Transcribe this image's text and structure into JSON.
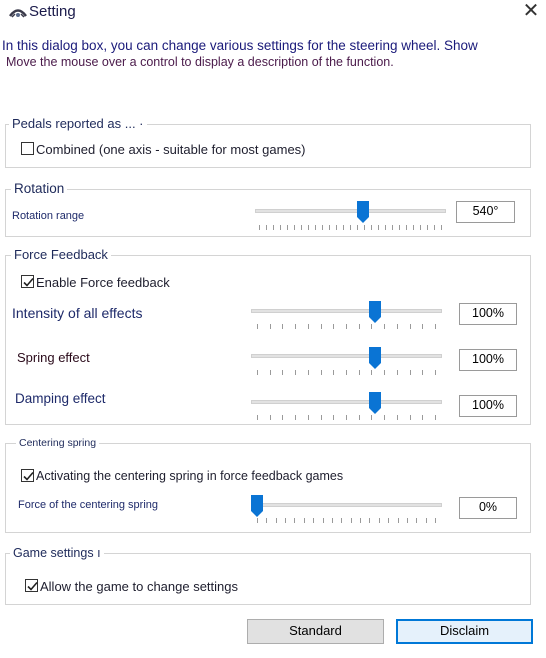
{
  "window": {
    "title": "Setting",
    "close_glyph": "✕"
  },
  "description": {
    "line1": "In this dialog box, you can change various settings for the steering wheel. Show",
    "line2": "Move the mouse over a control to display a description of the function."
  },
  "pedals": {
    "group_label": "Pedals reported as ...   ·",
    "combined_label": "Combined (one axis - suitable for most games)",
    "combined_checked": false
  },
  "rotation": {
    "group_label": "Rotation",
    "range_label": "Rotation range",
    "value": "540°",
    "level": 0.57
  },
  "force_feedback": {
    "group_label": "Force Feedback",
    "enable_label": "Enable Force feedback",
    "enable_checked": true,
    "intensity_label": "Intensity of all effects",
    "intensity_value": "100%",
    "intensity_level": 0.66,
    "spring_label": "Spring effect",
    "spring_value": "100%",
    "spring_level": 0.66,
    "damping_label": "Damping effect",
    "damping_value": "100%",
    "damping_level": 0.66
  },
  "centering": {
    "group_label": "Centering spring",
    "activate_label": "Activating the centering spring in force feedback games",
    "activate_checked": true,
    "force_label": "Force of the centering spring",
    "force_value": "0%",
    "force_level": 0.0
  },
  "game": {
    "group_label": "Game settings   ı",
    "allow_label": "Allow the game to change settings",
    "allow_checked": true
  },
  "buttons": {
    "standard": "Standard",
    "disclaim": "Disclaim"
  },
  "colors": {
    "accent": "#0078d7",
    "thumb": "#0a74d4"
  }
}
